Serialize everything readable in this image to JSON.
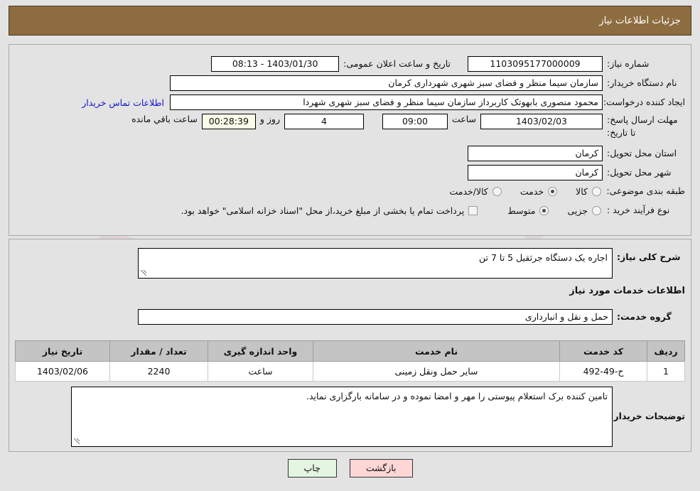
{
  "header": {
    "title": "جزئیات اطلاعات نیاز"
  },
  "watermark": {
    "text": "AnaTender.net"
  },
  "form": {
    "need_number_label": "شماره نیاز:",
    "need_number_value": "1103095177000009",
    "public_announce_label": "تاریخ و ساعت اعلان عمومی:",
    "public_announce_value": "1403/01/30 - 08:13",
    "buyer_org_label": "نام دستگاه خریدار:",
    "buyer_org_value": "سازمان سیما منظر و فضای سبز شهری شهرداری کرمان",
    "creator_label": "ایجاد کننده درخواست:",
    "creator_value": "محمود منصوری بابهوتک کاربرداز سازمان سیما منظر و فضای سبز شهری شهردا",
    "contact_link": "اطلاعات تماس خریدار",
    "deadline_label": "مهلت ارسال پاسخ: تا تاریخ:",
    "deadline_date": "1403/02/03",
    "hour_label": "ساعت",
    "deadline_time": "09:00",
    "days_remaining": "4",
    "days_label": "روز و",
    "timer": "00:28:39",
    "remaining_label": "ساعت باقي مانده",
    "province_label": "استان محل تحویل:",
    "province_value": "کرمان",
    "city_label": "شهر محل تحویل:",
    "city_value": "کرمان",
    "category_label": "طبقه بندی موضوعی:",
    "category_options": [
      {
        "label": "کالا",
        "selected": false
      },
      {
        "label": "خدمت",
        "selected": true
      },
      {
        "label": "کالا/خدمت",
        "selected": false
      }
    ],
    "process_label": "نوع فرآیند خرید :",
    "process_options": [
      {
        "label": "جزیی",
        "selected": false
      },
      {
        "label": "متوسط",
        "selected": true
      }
    ],
    "treasury_checkbox_label": "پرداخت تمام یا بخشی از مبلغ خرید،از محل \"اسناد خزانه اسلامی\" خواهد بود.",
    "treasury_checked": false
  },
  "need": {
    "summary_label": "شرح کلی نیاز:",
    "summary_value": "اجاره یک دستگاه جرثقیل 5 تا 7 تن",
    "services_section_title": "اطلاعات خدمات مورد نیاز",
    "service_group_label": "گروه خدمت:",
    "service_group_value": "حمل و نقل و انبارداری"
  },
  "table": {
    "columns": [
      "ردیف",
      "کد خدمت",
      "نام خدمت",
      "واحد اندازه گیری",
      "تعداد / مقدار",
      "تاریخ نیاز"
    ],
    "rows": [
      {
        "row": "1",
        "code": "ح-49-492",
        "name": "سایر حمل ونقل زمینی",
        "unit": "ساعت",
        "quantity": "2240",
        "date": "1403/02/06"
      }
    ]
  },
  "buyer_notes": {
    "label": "توضیحات خریدار:",
    "value": "تامین کننده برک استعلام پیوستی را مهر و امضا نموده و در سامانه بارگزاری نماید."
  },
  "buttons": {
    "back": "بازگشت",
    "print": "چاپ"
  },
  "colors": {
    "header_bar": "#8d6d3f",
    "page_bg": "#e3e3e3",
    "link": "#1414cf",
    "table_header": "#c4c4c4",
    "btn_back": "#ffd6d6",
    "btn_print": "#e4f6e2",
    "timer_bg": "#fbfbe8"
  }
}
